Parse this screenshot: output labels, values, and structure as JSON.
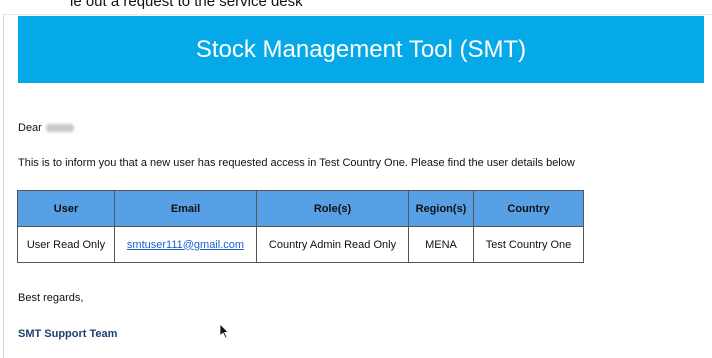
{
  "partial_header_text": "ie out a request to the service desk",
  "banner": {
    "title": "Stock Management Tool (SMT)"
  },
  "email": {
    "greeting": "Dear",
    "intro": "This is to inform you that a new user has requested access in Test Country One. Please find the user details below",
    "table": {
      "headers": [
        "User",
        "Email",
        "Role(s)",
        "Region(s)",
        "Country"
      ],
      "rows": [
        [
          "User Read Only",
          "smtuser111@gmail.com",
          "Country Admin Read Only",
          "MENA",
          "Test Country One"
        ]
      ]
    },
    "closing": "Best regards,",
    "signature": "SMT Support Team"
  },
  "colors": {
    "banner_bg": "#06a9e8",
    "table_header_bg": "#57a0e6",
    "link": "#1a5fd0",
    "signature": "#1f3f73"
  },
  "icons": {
    "cursor": "mouse-pointer-icon"
  }
}
